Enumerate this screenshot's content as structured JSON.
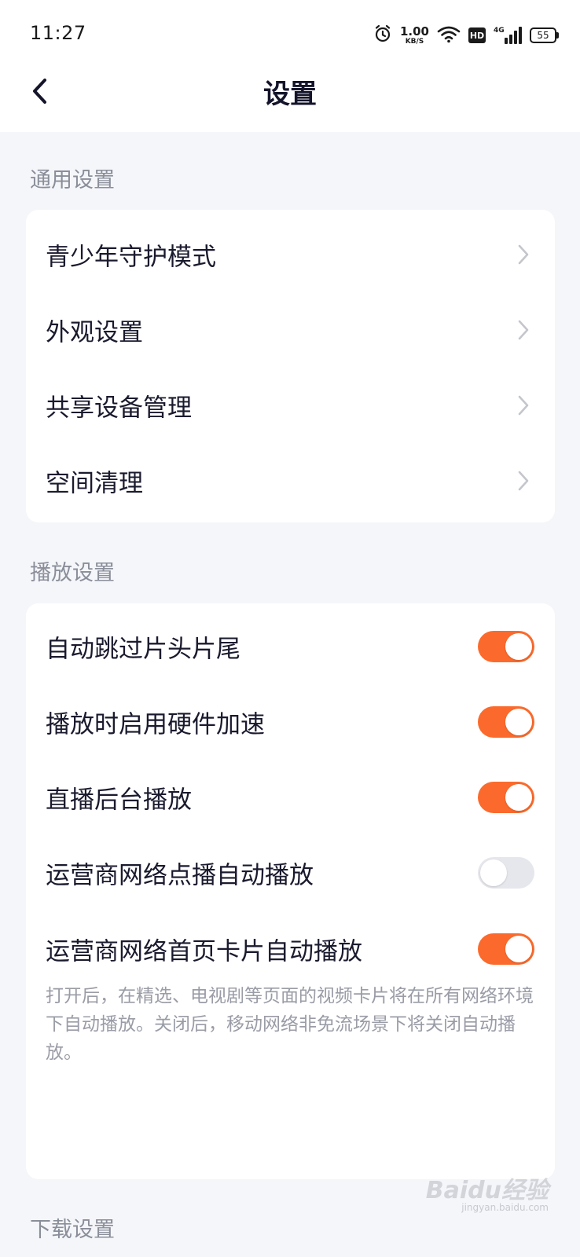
{
  "status_bar": {
    "time": "11:27",
    "net_speed_value": "1.00",
    "net_speed_unit": "KB/S",
    "hd_label": "HD",
    "signal_label": "4G",
    "battery": "55",
    "icons": [
      "alarm-icon",
      "wifi-icon",
      "signal-icon",
      "battery-icon"
    ]
  },
  "header": {
    "title": "设置",
    "back_icon": "chevron-left-icon"
  },
  "sections": {
    "general": {
      "title": "通用设置",
      "items": [
        {
          "label": "青少年守护模式"
        },
        {
          "label": "外观设置"
        },
        {
          "label": "共享设备管理"
        },
        {
          "label": "空间清理"
        }
      ]
    },
    "playback": {
      "title": "播放设置",
      "items": [
        {
          "label": "自动跳过片头片尾",
          "on": true
        },
        {
          "label": "播放时启用硬件加速",
          "on": true
        },
        {
          "label": "直播后台播放",
          "on": true
        },
        {
          "label": "运营商网络点播自动播放",
          "on": false
        },
        {
          "label": "运营商网络首页卡片自动播放",
          "on": true
        }
      ],
      "description": "打开后，在精选、电视剧等页面的视频卡片将在所有网络环境下自动播放。关闭后，移动网络非免流场景下将关闭自动播放。"
    },
    "download": {
      "title": "下载设置"
    }
  },
  "watermark": {
    "text": "Baidu经验",
    "sub": "jingyan.baidu.com"
  },
  "colors": {
    "accent": "#fb6a2c",
    "toggle_off": "#e6e7ec",
    "background": "#f5f6fa"
  }
}
